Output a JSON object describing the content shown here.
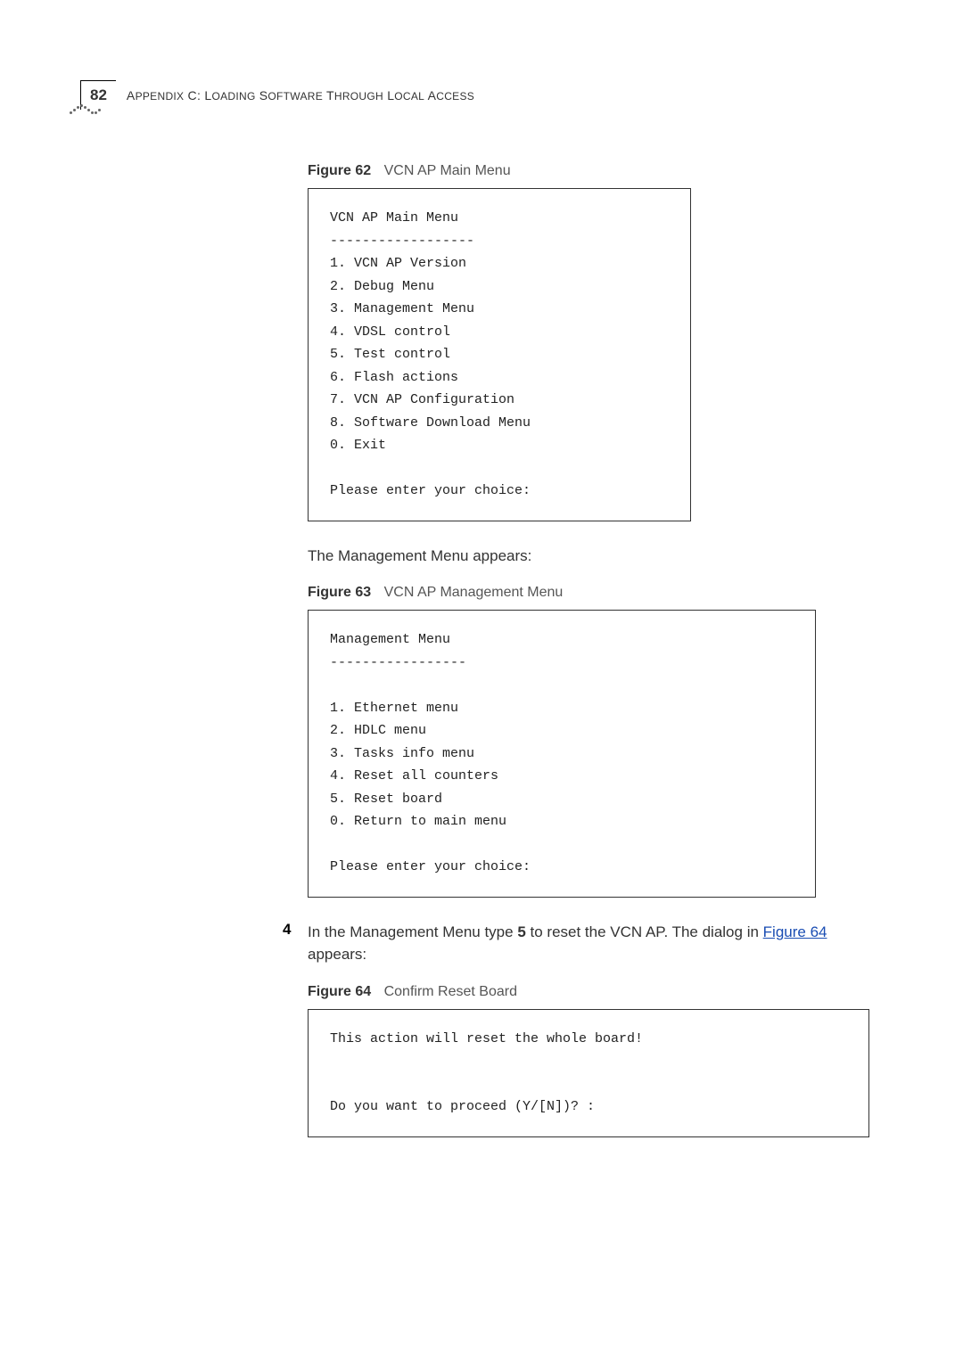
{
  "header": {
    "page_number": "82",
    "running_head_prefix": "A",
    "running_head_mid1": "PPENDIX",
    "running_head_c": " C: L",
    "running_head_mid2": "OADING",
    "running_head_s": " S",
    "running_head_mid3": "OFTWARE",
    "running_head_t": " T",
    "running_head_mid4": "HROUGH",
    "running_head_l": " L",
    "running_head_mid5": "OCAL",
    "running_head_a2": " A",
    "running_head_mid6": "CCESS"
  },
  "fig62": {
    "label": "Figure 62",
    "title": "VCN AP Main Menu",
    "code": "VCN AP Main Menu\n------------------\n1. VCN AP Version\n2. Debug Menu\n3. Management Menu\n4. VDSL control\n5. Test control\n6. Flash actions\n7. VCN AP Configuration\n8. Software Download Menu\n0. Exit\n\nPlease enter your choice:"
  },
  "para1": "The Management Menu appears:",
  "fig63": {
    "label": "Figure 63",
    "title": "VCN AP Management Menu",
    "code": "Management Menu\n-----------------\n\n1. Ethernet menu\n2. HDLC menu\n3. Tasks info menu\n4. Reset all counters\n5. Reset board\n0. Return to main menu\n\nPlease enter your choice:"
  },
  "step4": {
    "num": "4",
    "text_a": "In the Management Menu type ",
    "key": "5",
    "text_b": " to reset the VCN AP. The dialog in ",
    "link": "Figure 64",
    "text_c": " appears:"
  },
  "fig64": {
    "label": "Figure 64",
    "title": "Confirm Reset Board",
    "code": "This action will reset the whole board!\n\n\nDo you want to proceed (Y/[N])? :"
  }
}
